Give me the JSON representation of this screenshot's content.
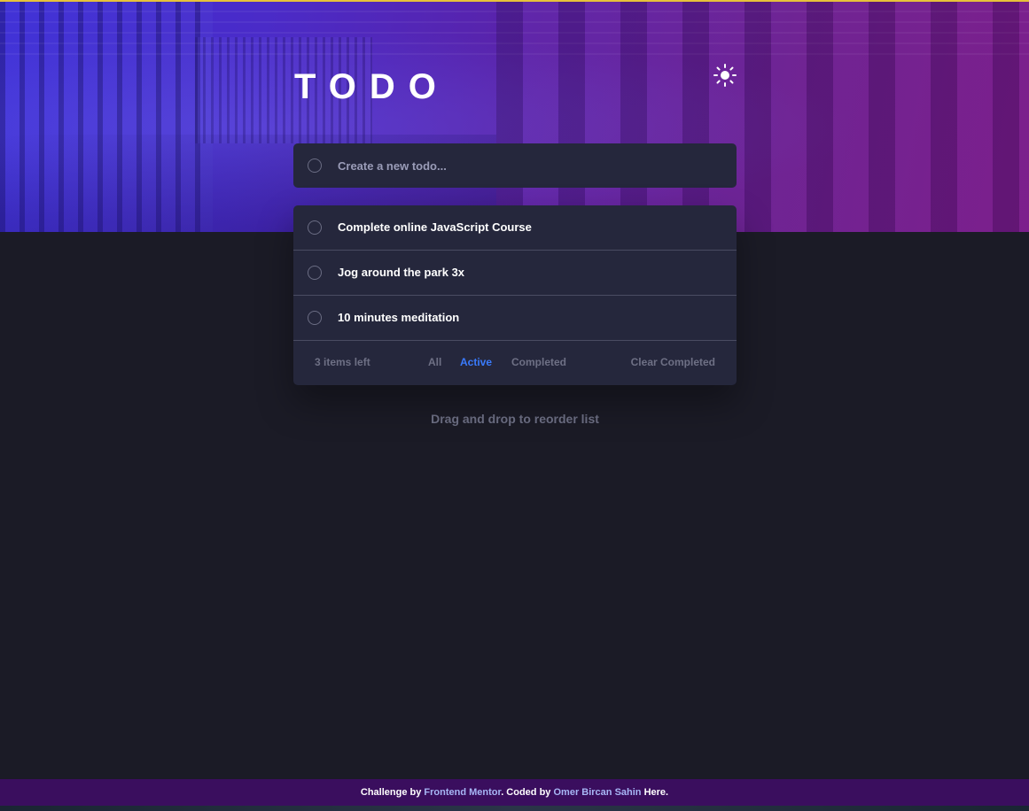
{
  "app": {
    "title": "TODO",
    "theme_toggle_icon": "sun-icon"
  },
  "new_todo": {
    "placeholder": "Create a new todo..."
  },
  "todos": [
    {
      "label": "Complete online JavaScript Course",
      "completed": false
    },
    {
      "label": "Jog around the park 3x",
      "completed": false
    },
    {
      "label": "10 minutes meditation",
      "completed": false
    }
  ],
  "footer": {
    "items_left": "3 items left",
    "filters": {
      "all": "All",
      "active": "Active",
      "completed": "Completed"
    },
    "selected_filter": "Active",
    "clear_completed": "Clear Completed"
  },
  "hint": "Drag and drop to reorder list",
  "attribution": {
    "prefix": "Challenge by",
    "challenge_link": "Frontend Mentor",
    "middle": ". Coded by",
    "author_link": "Omer Bircan Sahin",
    "suffix": "Here."
  },
  "colors": {
    "accent": "#3a7bfd",
    "card": "#25273c",
    "background": "#181824",
    "attribution_bar": "#3a0e5e"
  }
}
